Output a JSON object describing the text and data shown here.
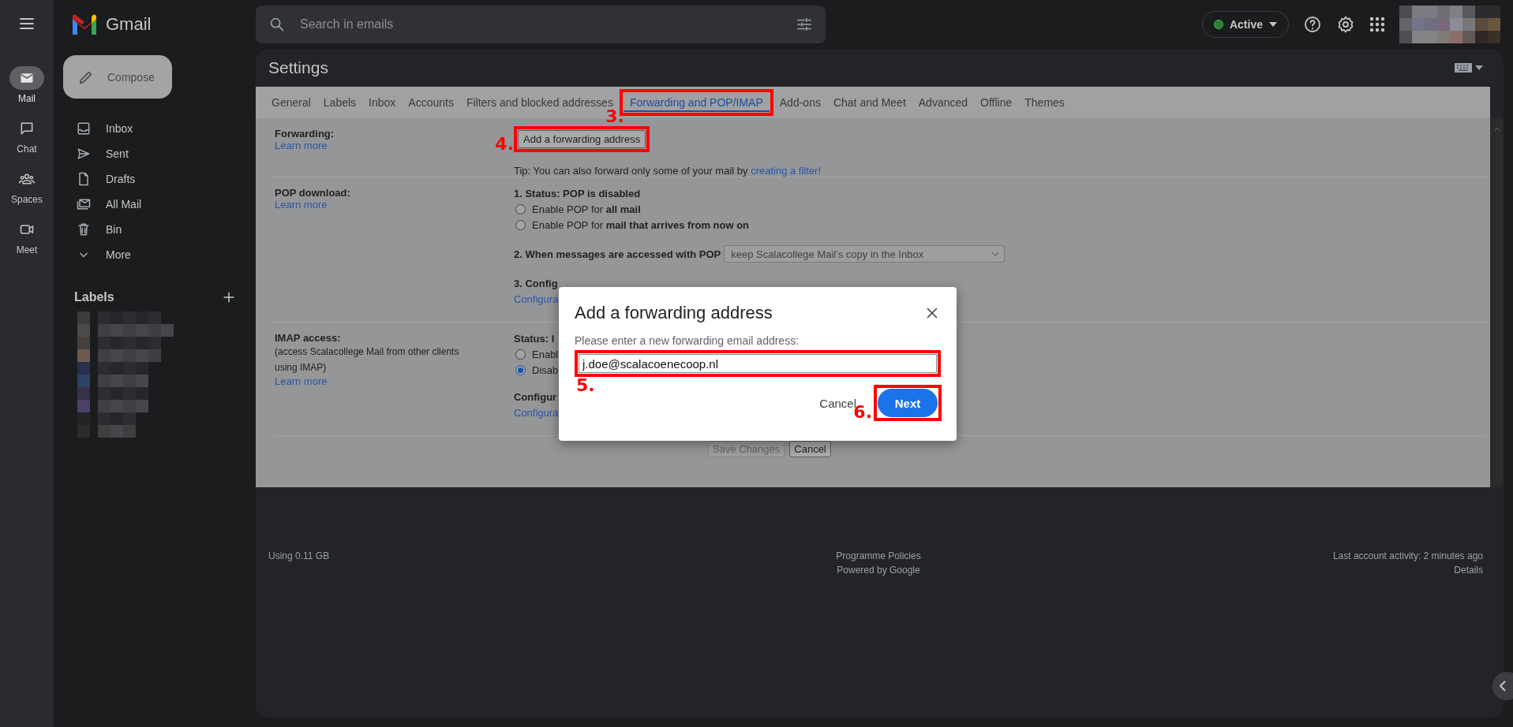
{
  "app": {
    "name": "Gmail"
  },
  "search": {
    "placeholder": "Search in emails"
  },
  "presence": {
    "label": "Active"
  },
  "rail": [
    {
      "label": "Mail",
      "kind": "mail",
      "selected": true
    },
    {
      "label": "Chat",
      "kind": "chat",
      "selected": false
    },
    {
      "label": "Spaces",
      "kind": "spaces",
      "selected": false
    },
    {
      "label": "Meet",
      "kind": "meet",
      "selected": false
    }
  ],
  "compose": "Compose",
  "nav": [
    {
      "label": "Inbox",
      "kind": "inbox"
    },
    {
      "label": "Sent",
      "kind": "sent"
    },
    {
      "label": "Drafts",
      "kind": "drafts"
    },
    {
      "label": "All Mail",
      "kind": "allmail"
    },
    {
      "label": "Bin",
      "kind": "bin"
    },
    {
      "label": "More",
      "kind": "more"
    }
  ],
  "labels_header": "Labels",
  "settings": {
    "title": "Settings",
    "tabs": [
      {
        "label": "General",
        "selected": false
      },
      {
        "label": "Labels",
        "selected": false
      },
      {
        "label": "Inbox",
        "selected": false
      },
      {
        "label": "Accounts",
        "selected": false
      },
      {
        "label": "Filters and blocked addresses",
        "selected": false
      },
      {
        "label": "Forwarding and POP/IMAP",
        "selected": true,
        "step": "3."
      },
      {
        "label": "Add-ons",
        "selected": false
      },
      {
        "label": "Chat and Meet",
        "selected": false
      },
      {
        "label": "Advanced",
        "selected": false
      },
      {
        "label": "Offline",
        "selected": false
      },
      {
        "label": "Themes",
        "selected": false
      }
    ],
    "forwarding": {
      "label": "Forwarding:",
      "link": "Learn more",
      "button": "Add a forwarding address",
      "button_step": "4.",
      "tip": "Tip: You can also forward only some of your mail by ",
      "tip_link": "creating a filter!"
    },
    "pop": {
      "label": "POP download:",
      "link": "Learn more",
      "status": "1. Status: POP is disabled",
      "options": [
        {
          "label": "Enable POP for **all mail**",
          "selected": false
        },
        {
          "label": "Enable POP for **mail that arrives from now on**",
          "selected": false
        }
      ],
      "access_label": "2. When messages are accessed with POP",
      "access_value": "keep Scalacollege Mail's copy in the Inbox",
      "config": "3. Config",
      "config_link": "Configura"
    },
    "imap": {
      "label": "IMAP access:",
      "note": "(access Scalacollege Mail from other clients using IMAP)",
      "link": "Learn more",
      "status": "Status: I",
      "options": [
        {
          "label": "Enabl",
          "selected": false
        },
        {
          "label": "Disab",
          "selected": true
        }
      ],
      "config": "Configur",
      "config_link": "Configura"
    },
    "actions": [
      {
        "label": "Save Changes",
        "disabled": true
      },
      {
        "label": "Cancel",
        "disabled": false
      }
    ]
  },
  "footer": {
    "storage": "Using 0.11 GB",
    "policies": "Programme Policies",
    "powered": "Powered by Google",
    "activity": "Last account activity: 2 minutes ago",
    "details": "Details"
  },
  "dialog": {
    "title": "Add a forwarding address",
    "prompt": "Please enter a new forwarding email address:",
    "value": "j.doe@scalacoenecoop.nl",
    "value_step": "5.",
    "buttons": [
      {
        "label": "Cancel",
        "kind": "text"
      },
      {
        "label": "Next",
        "kind": "primary",
        "step": "6."
      }
    ]
  }
}
